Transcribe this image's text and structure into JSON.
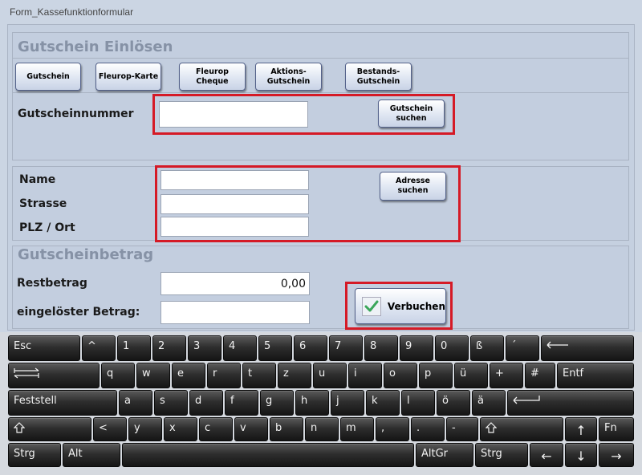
{
  "window": {
    "title": "Form_Kassefunktionformular"
  },
  "section_redeem": {
    "title": "Gutschein Einlösen",
    "type_buttons": [
      {
        "label": "Gutschein"
      },
      {
        "label": "Fleurop-Karte"
      },
      {
        "label": "Fleurop\nCheque"
      },
      {
        "label": "Aktions-\nGutschein"
      },
      {
        "label": "Bestands-\nGutschein"
      }
    ],
    "voucher_number_label": "Gutscheinnummer",
    "voucher_number_value": "",
    "search_voucher_button": "Gutschein\nsuchen"
  },
  "section_address": {
    "name_label": "Name",
    "street_label": "Strasse",
    "city_label": "PLZ / Ort",
    "name_value": "",
    "street_value": "",
    "city_value": "",
    "search_address_button": "Adresse\nsuchen"
  },
  "section_amount": {
    "title": "Gutscheinbetrag",
    "rest_label": "Restbetrag",
    "rest_value": "0,00",
    "redeemed_label": "eingelöster Betrag:",
    "redeemed_value": "",
    "book_button": "Verbuchen",
    "book_icon": "checkmark-icon"
  },
  "keyboard": {
    "row1": [
      "Esc",
      "^",
      "1",
      "2",
      "3",
      "4",
      "5",
      "6",
      "7",
      "8",
      "9",
      "0",
      "ß",
      "´"
    ],
    "row2": [
      "q",
      "w",
      "e",
      "r",
      "t",
      "z",
      "u",
      "i",
      "o",
      "p",
      "ü",
      "+",
      "#",
      "Entf"
    ],
    "row3": [
      "Feststell",
      "a",
      "s",
      "d",
      "f",
      "g",
      "h",
      "j",
      "k",
      "l",
      "ö",
      "ä"
    ],
    "row4": [
      "<",
      "y",
      "x",
      "c",
      "v",
      "b",
      "n",
      "m",
      ",",
      ".",
      "-",
      "Fn"
    ],
    "row5": [
      "Strg",
      "Alt",
      "AltGr",
      "Strg"
    ],
    "icons": {
      "backspace": "backspace-icon",
      "tab": "tab-icon",
      "enter": "enter-icon",
      "shift": "shift-icon",
      "arrow_up": "arrow-up-icon",
      "arrow_left": "arrow-left-icon",
      "arrow_down": "arrow-down-icon",
      "arrow_right": "arrow-right-icon"
    }
  },
  "colors": {
    "highlight": "#d51a26",
    "check": "#3aa65a",
    "background": "#cbd5e3"
  }
}
